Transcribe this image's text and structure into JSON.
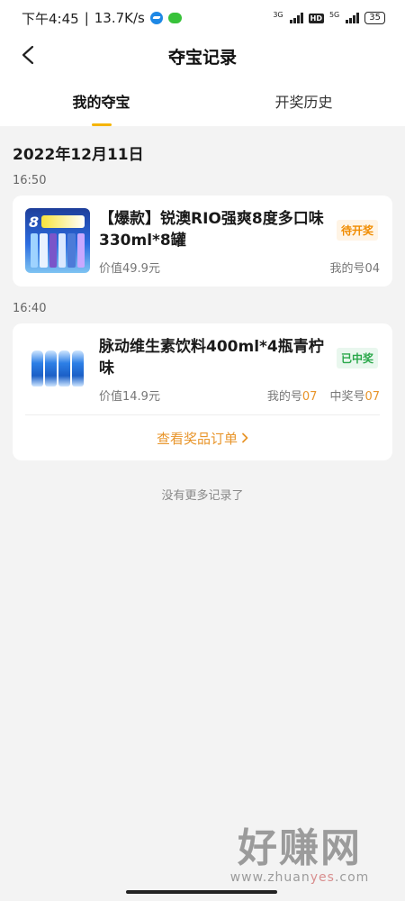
{
  "status_bar": {
    "time": "下午4:45",
    "speed": "13.7K/s",
    "net1": "3G",
    "hd": "HD",
    "net2": "5G",
    "battery": "35"
  },
  "nav": {
    "title": "夺宝记录"
  },
  "tabs": [
    {
      "label": "我的夺宝",
      "active": true
    },
    {
      "label": "开奖历史",
      "active": false
    }
  ],
  "date_header": "2022年12月11日",
  "records": [
    {
      "time": "16:50",
      "name": "【爆款】锐澳RIO强爽8度多口味330ml*8罐",
      "price": "价值49.9元",
      "status": "待开奖",
      "my_label": "我的号",
      "my_number": "04"
    },
    {
      "time": "16:40",
      "name": "脉动维生素饮料400ml*4瓶青柠味",
      "price": "价值14.9元",
      "status": "已中奖",
      "my_label": "我的号",
      "my_number": "07",
      "win_label": "中奖号",
      "win_number": "07",
      "order_link": "查看奖品订单"
    }
  ],
  "footer_text": "没有更多记录了",
  "watermark": {
    "logo": "好赚网",
    "url_pre": "www.zhuan",
    "url_yes": "yes",
    "url_post": ".com"
  },
  "colors": {
    "accent": "#f5b400",
    "pending": "#f08c00",
    "won": "#2aa84a",
    "highlight": "#e8952b"
  }
}
